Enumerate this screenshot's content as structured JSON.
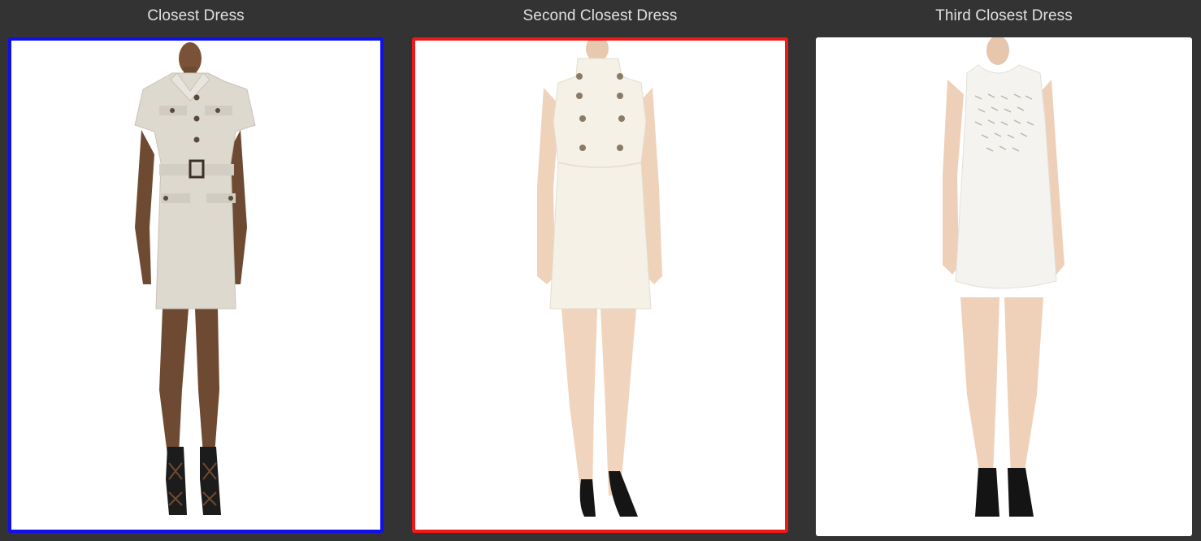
{
  "results": [
    {
      "title": "Closest Dress",
      "border_color": "#1010ee",
      "dress_color": "#ddd9cf",
      "footwear": "black lace-up sandals",
      "image_label": "short-sleeve belted shirt dress"
    },
    {
      "title": "Second Closest Dress",
      "border_color": "#ee1a1a",
      "dress_color": "#f5f1e6",
      "footwear": "black pumps",
      "image_label": "sleeveless mock-neck double-button dress"
    },
    {
      "title": "Third Closest Dress",
      "border_color": "none",
      "dress_color": "#f4f3ef",
      "footwear": "black ankle boots",
      "image_label": "sleeveless shift dress with embellished bodice"
    }
  ]
}
